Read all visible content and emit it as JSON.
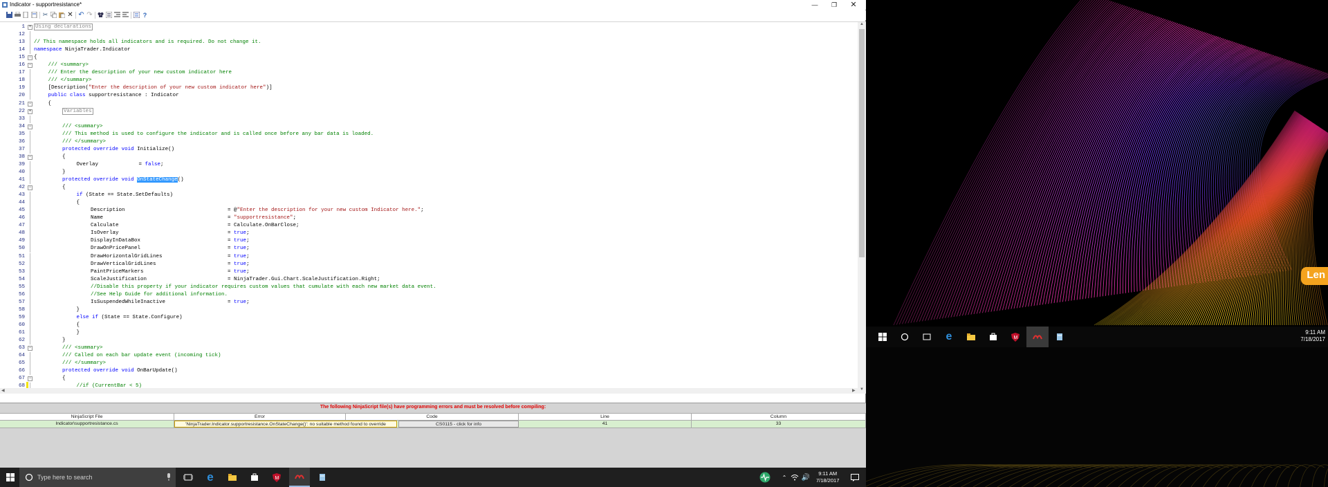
{
  "window": {
    "title": "Indicator - supportresistance*"
  },
  "code_lines": [
    {
      "n": "1",
      "fold": "+",
      "indent": 0,
      "parts": [
        {
          "t": "Using declarations",
          "c": "region"
        }
      ]
    },
    {
      "n": "12",
      "indent": 0,
      "parts": []
    },
    {
      "n": "13",
      "indent": 0,
      "parts": [
        {
          "t": "// This namespace holds all indicators and is required. Do not change it.",
          "c": "cm"
        }
      ]
    },
    {
      "n": "14",
      "indent": 0,
      "parts": [
        {
          "t": "namespace",
          "c": "kw"
        },
        {
          "t": " NinjaTrader.Indicator",
          "c": ""
        }
      ]
    },
    {
      "n": "15",
      "fold": "-",
      "indent": 0,
      "parts": [
        {
          "t": "{",
          "c": ""
        }
      ]
    },
    {
      "n": "16",
      "fold": "-",
      "indent": 1,
      "parts": [
        {
          "t": "/// <summary>",
          "c": "cm"
        }
      ]
    },
    {
      "n": "17",
      "indent": 1,
      "parts": [
        {
          "t": "/// Enter the description of your new custom indicator here",
          "c": "cm"
        }
      ]
    },
    {
      "n": "18",
      "indent": 1,
      "parts": [
        {
          "t": "/// </summary>",
          "c": "cm"
        }
      ]
    },
    {
      "n": "19",
      "indent": 1,
      "parts": [
        {
          "t": "[Description(",
          "c": ""
        },
        {
          "t": "\"Enter the description of your new custom indicator here\"",
          "c": "st"
        },
        {
          "t": ")]",
          "c": ""
        }
      ]
    },
    {
      "n": "20",
      "indent": 1,
      "parts": [
        {
          "t": "public",
          "c": "kw"
        },
        {
          "t": " ",
          "c": ""
        },
        {
          "t": "class",
          "c": "kw"
        },
        {
          "t": " supportresistance : Indicator",
          "c": ""
        }
      ]
    },
    {
      "n": "21",
      "fold": "-",
      "indent": 1,
      "parts": [
        {
          "t": "{",
          "c": ""
        }
      ]
    },
    {
      "n": "22",
      "fold": "+",
      "indent": 2,
      "parts": [
        {
          "t": "Variables",
          "c": "region"
        }
      ]
    },
    {
      "n": "33",
      "indent": 0,
      "parts": []
    },
    {
      "n": "34",
      "fold": "-",
      "indent": 2,
      "parts": [
        {
          "t": "/// <summary>",
          "c": "cm"
        }
      ]
    },
    {
      "n": "35",
      "indent": 2,
      "parts": [
        {
          "t": "/// This method is used to configure the indicator and is called once before any bar data is loaded.",
          "c": "cm"
        }
      ]
    },
    {
      "n": "36",
      "indent": 2,
      "parts": [
        {
          "t": "/// </summary>",
          "c": "cm"
        }
      ]
    },
    {
      "n": "37",
      "indent": 2,
      "parts": [
        {
          "t": "protected",
          "c": "kw"
        },
        {
          "t": " ",
          "c": ""
        },
        {
          "t": "override",
          "c": "kw"
        },
        {
          "t": " ",
          "c": ""
        },
        {
          "t": "void",
          "c": "kw"
        },
        {
          "t": " Initialize()",
          "c": ""
        }
      ]
    },
    {
      "n": "38",
      "fold": "-",
      "indent": 2,
      "parts": [
        {
          "t": "{",
          "c": ""
        }
      ]
    },
    {
      "n": "39",
      "indent": 3,
      "parts": [
        {
          "t": "Overlay             = ",
          "c": ""
        },
        {
          "t": "false",
          "c": "kw"
        },
        {
          "t": ";",
          "c": ""
        }
      ]
    },
    {
      "n": "40",
      "indent": 2,
      "parts": [
        {
          "t": "}",
          "c": ""
        }
      ]
    },
    {
      "n": "41",
      "indent": 2,
      "parts": [
        {
          "t": "protected",
          "c": "kw"
        },
        {
          "t": " ",
          "c": ""
        },
        {
          "t": "override",
          "c": "kw"
        },
        {
          "t": " ",
          "c": ""
        },
        {
          "t": "void",
          "c": "kw"
        },
        {
          "t": " ",
          "c": ""
        },
        {
          "t": "OnStateChange",
          "c": "hl"
        },
        {
          "t": "()",
          "c": ""
        }
      ]
    },
    {
      "n": "42",
      "fold": "-",
      "indent": 2,
      "parts": [
        {
          "t": "{",
          "c": ""
        }
      ]
    },
    {
      "n": "43",
      "indent": 3,
      "parts": [
        {
          "t": "if",
          "c": "kw"
        },
        {
          "t": " (State == State.SetDefaults)",
          "c": ""
        }
      ]
    },
    {
      "n": "44",
      "indent": 3,
      "parts": [
        {
          "t": "{",
          "c": ""
        }
      ]
    },
    {
      "n": "45",
      "indent": 4,
      "parts": [
        {
          "t": "Description                                 = @",
          "c": ""
        },
        {
          "t": "\"Enter the description for your new custom Indicator here.\"",
          "c": "st"
        },
        {
          "t": ";",
          "c": ""
        }
      ]
    },
    {
      "n": "46",
      "indent": 4,
      "parts": [
        {
          "t": "Name                                        = ",
          "c": ""
        },
        {
          "t": "\"supportresistance\"",
          "c": "st"
        },
        {
          "t": ";",
          "c": ""
        }
      ]
    },
    {
      "n": "47",
      "indent": 4,
      "parts": [
        {
          "t": "Calculate                                   = Calculate.OnBarClose;",
          "c": ""
        }
      ]
    },
    {
      "n": "48",
      "indent": 4,
      "parts": [
        {
          "t": "IsOverlay                                   = ",
          "c": ""
        },
        {
          "t": "true",
          "c": "kw"
        },
        {
          "t": ";",
          "c": ""
        }
      ]
    },
    {
      "n": "49",
      "indent": 4,
      "parts": [
        {
          "t": "DisplayInDataBox                            = ",
          "c": ""
        },
        {
          "t": "true",
          "c": "kw"
        },
        {
          "t": ";",
          "c": ""
        }
      ]
    },
    {
      "n": "50",
      "indent": 4,
      "parts": [
        {
          "t": "DrawOnPricePanel                            = ",
          "c": ""
        },
        {
          "t": "true",
          "c": "kw"
        },
        {
          "t": ";",
          "c": ""
        }
      ]
    },
    {
      "n": "51",
      "indent": 4,
      "parts": [
        {
          "t": "DrawHorizontalGridLines                     = ",
          "c": ""
        },
        {
          "t": "true",
          "c": "kw"
        },
        {
          "t": ";",
          "c": ""
        }
      ]
    },
    {
      "n": "52",
      "indent": 4,
      "parts": [
        {
          "t": "DrawVerticalGridLines                       = ",
          "c": ""
        },
        {
          "t": "true",
          "c": "kw"
        },
        {
          "t": ";",
          "c": ""
        }
      ]
    },
    {
      "n": "53",
      "indent": 4,
      "parts": [
        {
          "t": "PaintPriceMarkers                           = ",
          "c": ""
        },
        {
          "t": "true",
          "c": "kw"
        },
        {
          "t": ";",
          "c": ""
        }
      ]
    },
    {
      "n": "54",
      "indent": 4,
      "parts": [
        {
          "t": "ScaleJustification                          = NinjaTrader.Gui.Chart.ScaleJustification.Right;",
          "c": ""
        }
      ]
    },
    {
      "n": "55",
      "indent": 4,
      "parts": [
        {
          "t": "//Disable this property if your indicator requires custom values that cumulate with each new market data event.",
          "c": "cm"
        }
      ]
    },
    {
      "n": "56",
      "indent": 4,
      "parts": [
        {
          "t": "//See Help Guide for additional information.",
          "c": "cm"
        }
      ]
    },
    {
      "n": "57",
      "indent": 4,
      "parts": [
        {
          "t": "IsSuspendedWhileInactive                    = ",
          "c": ""
        },
        {
          "t": "true",
          "c": "kw"
        },
        {
          "t": ";",
          "c": ""
        }
      ]
    },
    {
      "n": "58",
      "indent": 3,
      "parts": [
        {
          "t": "}",
          "c": ""
        }
      ]
    },
    {
      "n": "59",
      "indent": 3,
      "parts": [
        {
          "t": "else",
          "c": "kw"
        },
        {
          "t": " ",
          "c": ""
        },
        {
          "t": "if",
          "c": "kw"
        },
        {
          "t": " (State == State.Configure)",
          "c": ""
        }
      ]
    },
    {
      "n": "60",
      "indent": 3,
      "parts": [
        {
          "t": "{",
          "c": ""
        }
      ]
    },
    {
      "n": "61",
      "indent": 3,
      "parts": [
        {
          "t": "}",
          "c": ""
        }
      ]
    },
    {
      "n": "62",
      "indent": 2,
      "parts": [
        {
          "t": "}",
          "c": ""
        }
      ]
    },
    {
      "n": "63",
      "fold": "-",
      "indent": 2,
      "parts": [
        {
          "t": "/// <summary>",
          "c": "cm"
        }
      ]
    },
    {
      "n": "64",
      "indent": 2,
      "parts": [
        {
          "t": "/// Called on each bar update event (incoming tick)",
          "c": "cm"
        }
      ]
    },
    {
      "n": "65",
      "indent": 2,
      "parts": [
        {
          "t": "/// </summary>",
          "c": "cm"
        }
      ]
    },
    {
      "n": "66",
      "indent": 2,
      "parts": [
        {
          "t": "protected",
          "c": "kw"
        },
        {
          "t": " ",
          "c": ""
        },
        {
          "t": "override",
          "c": "kw"
        },
        {
          "t": " ",
          "c": ""
        },
        {
          "t": "void",
          "c": "kw"
        },
        {
          "t": " OnBarUpdate()",
          "c": ""
        }
      ]
    },
    {
      "n": "67",
      "fold": "-",
      "indent": 2,
      "parts": [
        {
          "t": "{",
          "c": ""
        }
      ]
    },
    {
      "n": "68",
      "indent": 3,
      "parts": [
        {
          "t": "//if (CurrentBar < 5)",
          "c": "cm"
        }
      ]
    }
  ],
  "errors": {
    "title": "The following NinjaScript file(s) have programming errors and must be resolved before compiling:",
    "columns": [
      "NinjaScript File",
      "Error",
      "Code",
      "Line",
      "Column"
    ],
    "rows": [
      {
        "file": "Indicator\\supportresistance.cs",
        "error": "'NinjaTrader.Indicator.supportresistance.OnStateChange()': no suitable method found to override",
        "code": "CS0115 - click for info",
        "line": "41",
        "column": "33"
      }
    ]
  },
  "taskbar": {
    "search_placeholder": "Type here to search",
    "time": "9:11 AM",
    "date": "7/18/2017"
  },
  "taskbar2": {
    "time": "9:11 AM",
    "date": "7/18/2017"
  },
  "wallpaper": {
    "badge": "Len"
  },
  "colors": {
    "keyword": "#0000ff",
    "comment": "#008000",
    "string": "#a31515",
    "error_title": "#e00000",
    "selection": "#3399ff",
    "error_row": "#d8efcf"
  }
}
